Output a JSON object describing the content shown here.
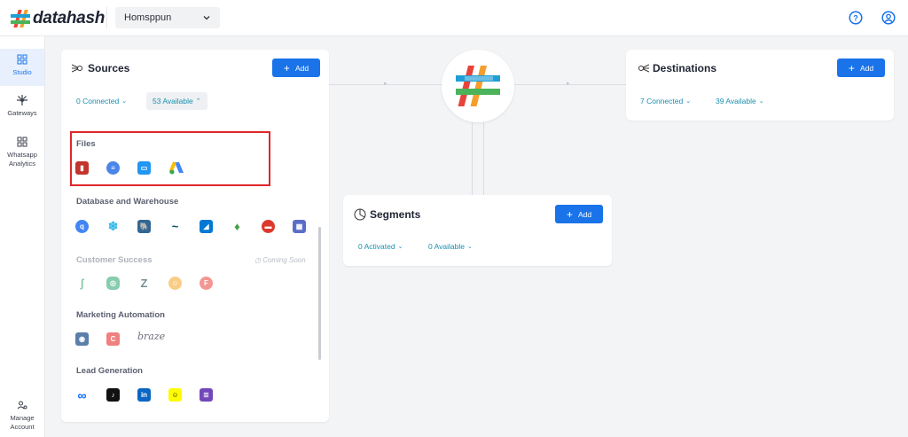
{
  "app": {
    "name": "datahash"
  },
  "topbar": {
    "workspace": "Homsppun"
  },
  "sidebar": {
    "items": [
      {
        "label": "Studio",
        "icon": "grid-icon"
      },
      {
        "label": "Gateways",
        "icon": "gateway-icon"
      },
      {
        "label": "Whatsapp Analytics",
        "icon": "grid-icon"
      },
      {
        "label": "Manage Account",
        "icon": "user-settings-icon"
      }
    ]
  },
  "sources": {
    "title": "Sources",
    "add_label": "Add",
    "connected": "0 Connected",
    "available": "53 Available",
    "sections": [
      {
        "title": "Files",
        "icons": [
          "aws-s3-icon",
          "gcs-icon",
          "file-upload-icon",
          "google-ads-icon"
        ]
      },
      {
        "title": "Database and Warehouse",
        "icons": [
          "bigquery-icon",
          "snowflake-icon",
          "postgres-icon",
          "mysql-icon",
          "azure-sql-icon",
          "mongodb-icon",
          "redis-icon",
          "redshift-icon"
        ]
      },
      {
        "title": "Customer Success",
        "badge": "Coming Soon",
        "icons": [
          "chatbot-icon",
          "freshdesk-icon",
          "zendesk-icon",
          "intercom-icon",
          "freshchat-icon"
        ]
      },
      {
        "title": "Marketing Automation",
        "icons": [
          "clevertap-icon",
          "moengage-icon",
          "braze-icon"
        ],
        "braze_text": "braze"
      },
      {
        "title": "Lead Generation",
        "icons": [
          "meta-icon",
          "tiktok-icon",
          "linkedin-icon",
          "snapchat-icon",
          "google-forms-icon"
        ]
      }
    ]
  },
  "segments": {
    "title": "Segments",
    "add_label": "Add",
    "activated": "0 Activated",
    "available": "0 Available"
  },
  "destinations": {
    "title": "Destinations",
    "add_label": "Add",
    "connected": "7 Connected",
    "available": "39 Available"
  },
  "colors": {
    "accent": "#1a73e8",
    "link": "#1a8fb0",
    "highlight": "#e0262a"
  }
}
